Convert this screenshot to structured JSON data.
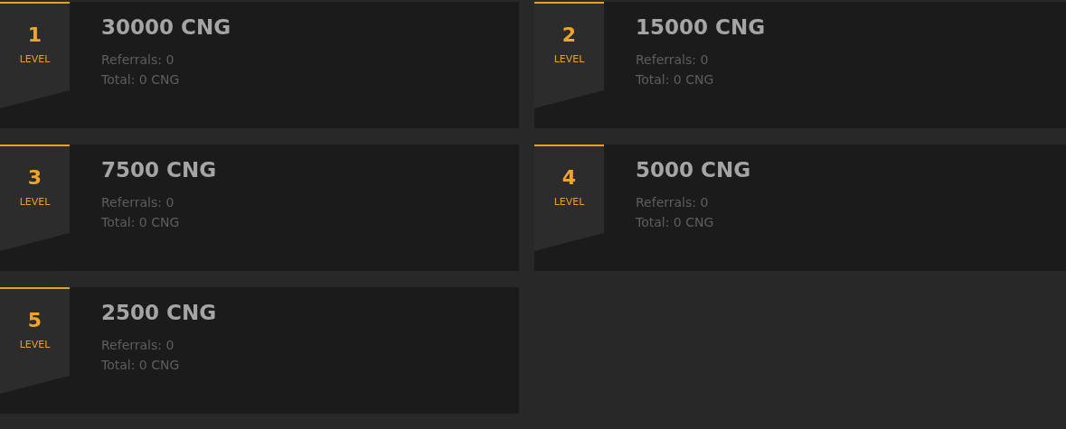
{
  "levels": [
    {
      "number": "1",
      "label": "LEVEL",
      "reward": "30000 CNG",
      "referrals": "Referrals: 0",
      "total": "Total: 0 CNG"
    },
    {
      "number": "2",
      "label": "LEVEL",
      "reward": "15000 CNG",
      "referrals": "Referrals: 0",
      "total": "Total: 0 CNG"
    },
    {
      "number": "3",
      "label": "LEVEL",
      "reward": "7500 CNG",
      "referrals": "Referrals: 0",
      "total": "Total: 0 CNG"
    },
    {
      "number": "4",
      "label": "LEVEL",
      "reward": "5000 CNG",
      "referrals": "Referrals: 0",
      "total": "Total: 0 CNG"
    },
    {
      "number": "5",
      "label": "LEVEL",
      "reward": "2500 CNG",
      "referrals": "Referrals: 0",
      "total": "Total: 0 CNG"
    }
  ]
}
